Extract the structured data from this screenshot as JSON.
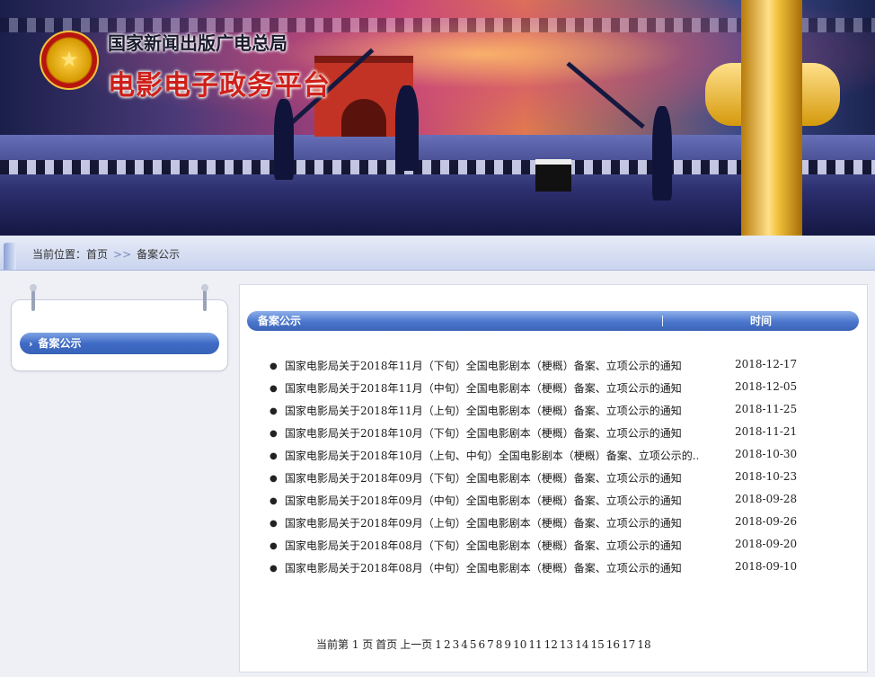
{
  "header": {
    "org_name": "国家新闻出版广电总局",
    "platform_name": "电影电子政务平台",
    "emblem_glyph": "★"
  },
  "breadcrumb": {
    "label": "当前位置：",
    "items": [
      "首页",
      "备案公示"
    ],
    "separator": ">>"
  },
  "sidebar": {
    "items": [
      {
        "label": "备案公示",
        "icon": "chevron-right-icon"
      }
    ]
  },
  "list": {
    "header_title": "备案公示",
    "header_time": "时间",
    "rows": [
      {
        "title": "国家电影局关于2018年11月（下旬）全国电影剧本（梗概）备案、立项公示的通知",
        "date": "2018-12-17"
      },
      {
        "title": "国家电影局关于2018年11月（中旬）全国电影剧本（梗概）备案、立项公示的通知",
        "date": "2018-12-05"
      },
      {
        "title": "国家电影局关于2018年11月（上旬）全国电影剧本（梗概）备案、立项公示的通知",
        "date": "2018-11-25"
      },
      {
        "title": "国家电影局关于2018年10月（下旬）全国电影剧本（梗概）备案、立项公示的通知",
        "date": "2018-11-21"
      },
      {
        "title": "国家电影局关于2018年10月（上旬、中旬）全国电影剧本（梗概）备案、立项公示的...",
        "date": "2018-10-30"
      },
      {
        "title": "国家电影局关于2018年09月（下旬）全国电影剧本（梗概）备案、立项公示的通知",
        "date": "2018-10-23"
      },
      {
        "title": "国家电影局关于2018年09月（中旬）全国电影剧本（梗概）备案、立项公示的通知",
        "date": "2018-09-28"
      },
      {
        "title": "国家电影局关于2018年09月（上旬）全国电影剧本（梗概）备案、立项公示的通知",
        "date": "2018-09-26"
      },
      {
        "title": "国家电影局关于2018年08月（下旬）全国电影剧本（梗概）备案、立项公示的通知",
        "date": "2018-09-20"
      },
      {
        "title": "国家电影局关于2018年08月（中旬）全国电影剧本（梗概）备案、立项公示的通知",
        "date": "2018-09-10"
      }
    ]
  },
  "pagination": {
    "current_label": "当前第 1 页",
    "first_label": "首页",
    "prev_label": "上一页",
    "pages": [
      "1",
      "2",
      "3",
      "4",
      "5",
      "6",
      "7",
      "8",
      "9",
      "10",
      "11",
      "12",
      "13",
      "14",
      "15",
      "16",
      "17",
      "18"
    ]
  },
  "colors": {
    "header_blue": "#4a76cc",
    "title_red": "#cf1f1a",
    "gold": "#f2c23d"
  }
}
